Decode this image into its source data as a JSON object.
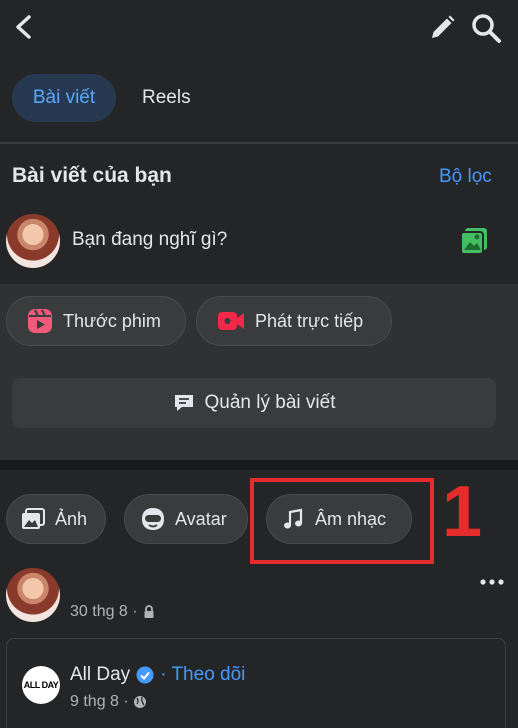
{
  "header": {
    "back_icon": "chevron-left-icon",
    "edit_icon": "pencil-icon",
    "search_icon": "search-icon"
  },
  "tabs": [
    {
      "label": "Bài viết",
      "active": true
    },
    {
      "label": "Reels",
      "active": false
    }
  ],
  "posts_section": {
    "title": "Bài viết của bạn",
    "filter_label": "Bộ lọc",
    "composer_placeholder": "Bạn đang nghĩ gì?",
    "actions": [
      {
        "label": "Thước phim",
        "icon": "reels-icon"
      },
      {
        "label": "Phát trực tiếp",
        "icon": "live-video-icon"
      }
    ],
    "manage_label": "Quản lý bài viết"
  },
  "filter_chips": [
    {
      "label": "Ảnh",
      "icon": "photo-icon"
    },
    {
      "label": "Avatar",
      "icon": "avatar-face-icon"
    },
    {
      "label": "Âm nhạc",
      "icon": "music-note-icon"
    }
  ],
  "annotation": {
    "step_number": "1",
    "color": "#e52c2c"
  },
  "post": {
    "time": "30 thg 8 ·",
    "shared": {
      "logo_text": "ALL DAY",
      "page_name": "All Day",
      "follow_label": "· Theo dõi",
      "time": "9 thg 8 ·"
    }
  },
  "colors": {
    "background": "#242526",
    "accent": "#4599ff",
    "chip": "#3a3b3c"
  }
}
